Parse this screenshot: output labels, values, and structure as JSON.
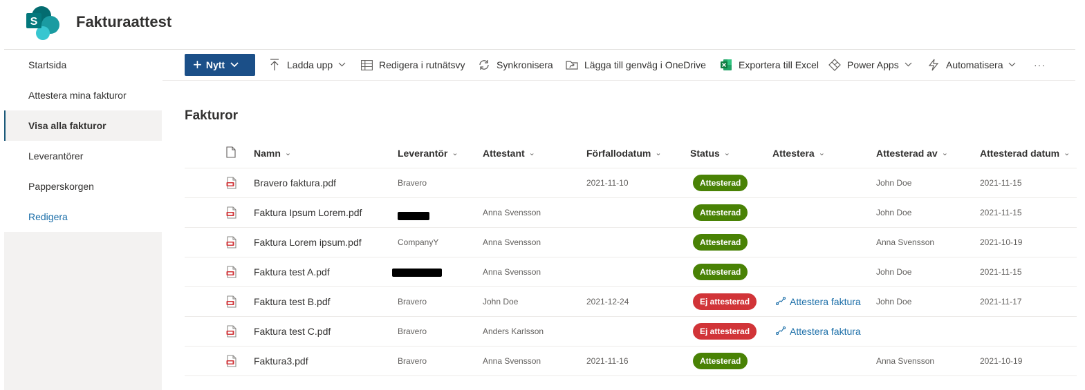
{
  "site": {
    "title": "Fakturaattest",
    "logo_letter": "S",
    "brand_colors": [
      "#036c70",
      "#1a9ba1",
      "#37c6d0"
    ]
  },
  "nav": {
    "items": [
      {
        "label": "Startsida",
        "selected": false
      },
      {
        "label": "Attestera mina fakturor",
        "selected": false
      },
      {
        "label": "Visa alla fakturor",
        "selected": true
      },
      {
        "label": "Leverantörer",
        "selected": false
      },
      {
        "label": "Papperskorgen",
        "selected": false
      }
    ],
    "edit_label": "Redigera"
  },
  "commandbar": {
    "new_label": "Nytt",
    "upload_label": "Ladda upp",
    "grid_label": "Redigera i rutnätsvy",
    "sync_label": "Synkronisera",
    "onedrive_label": "Lägga till genväg i OneDrive",
    "excel_label": "Exportera till Excel",
    "powerapps_label": "Power Apps",
    "automate_label": "Automatisera",
    "more_label": "···"
  },
  "library": {
    "title": "Fakturor"
  },
  "columns": {
    "name": "Namn",
    "supplier": "Leverantör",
    "approver": "Attestant",
    "due_date": "Förfallodatum",
    "status": "Status",
    "approve": "Attestera",
    "approved_by": "Attesterad av",
    "approved_date": "Attesterad datum"
  },
  "rows": [
    {
      "name": "Bravero faktura.pdf",
      "supplier": "Bravero",
      "approver": "",
      "due_date": "2021-11-10",
      "status": "Attesterad",
      "status_color": "#498205",
      "approve_action": "",
      "approved_by": "John Doe",
      "approved_date": "2021-11-15"
    },
    {
      "name": "Faktura Ipsum Lorem.pdf",
      "supplier": "",
      "approver": "Anna Svensson",
      "due_date": "",
      "status": "Attesterad",
      "status_color": "#498205",
      "approve_action": "",
      "approved_by": "John Doe",
      "approved_date": "2021-11-15"
    },
    {
      "name": "Faktura Lorem ipsum.pdf",
      "supplier": "CompanyY",
      "approver": "Anna Svensson",
      "due_date": "",
      "status": "Attesterad",
      "status_color": "#498205",
      "approve_action": "",
      "approved_by": "Anna Svensson",
      "approved_date": "2021-10-19"
    },
    {
      "name": "Faktura test A.pdf",
      "supplier": "",
      "approver": "Anna Svensson",
      "due_date": "",
      "status": "Attesterad",
      "status_color": "#498205",
      "approve_action": "",
      "approved_by": "John Doe",
      "approved_date": "2021-11-15"
    },
    {
      "name": "Faktura test B.pdf",
      "supplier": "Bravero",
      "approver": "John Doe",
      "due_date": "2021-12-24",
      "status": "Ej attesterad",
      "status_color": "#d13438",
      "approve_action": "Attestera faktura",
      "approved_by": "John Doe",
      "approved_date": "2021-11-17"
    },
    {
      "name": "Faktura test C.pdf",
      "supplier": "Bravero",
      "approver": "Anders Karlsson",
      "due_date": "",
      "status": "Ej attesterad",
      "status_color": "#d13438",
      "approve_action": "Attestera faktura",
      "approved_by": "",
      "approved_date": ""
    },
    {
      "name": "Faktura3.pdf",
      "supplier": "Bravero",
      "approver": "Anna Svensson",
      "due_date": "2021-11-16",
      "status": "Attesterad",
      "status_color": "#498205",
      "approve_action": "",
      "approved_by": "Anna Svensson",
      "approved_date": "2021-10-19"
    }
  ]
}
